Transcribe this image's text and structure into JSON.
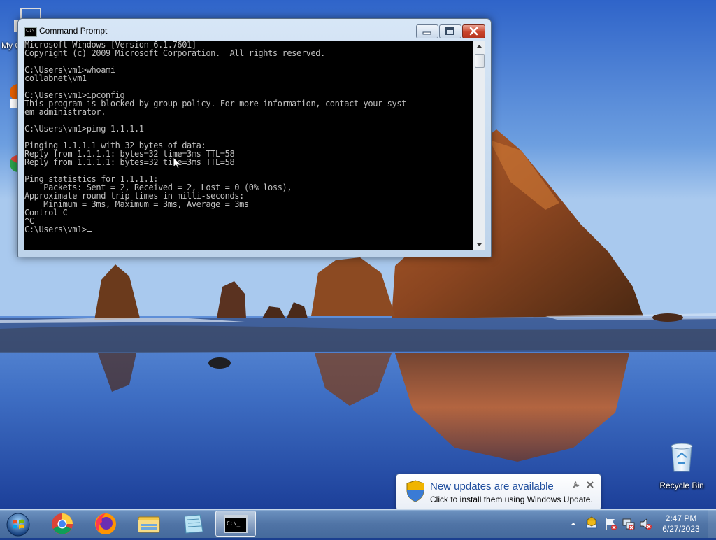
{
  "cmd": {
    "title": "Command Prompt",
    "lines": [
      "Microsoft Windows [Version 6.1.7601]",
      "Copyright (c) 2009 Microsoft Corporation.  All rights reserved.",
      "",
      "C:\\Users\\vm1>whoami",
      "collabnet\\vm1",
      "",
      "C:\\Users\\vm1>ipconfig",
      "This program is blocked by group policy. For more information, contact your syst",
      "em administrator.",
      "",
      "C:\\Users\\vm1>ping 1.1.1.1",
      "",
      "Pinging 1.1.1.1 with 32 bytes of data:",
      "Reply from 1.1.1.1: bytes=32 time=3ms TTL=58",
      "Reply from 1.1.1.1: bytes=32 time=3ms TTL=58",
      "",
      "Ping statistics for 1.1.1.1:",
      "    Packets: Sent = 2, Received = 2, Lost = 0 (0% loss),",
      "Approximate round trip times in milli-seconds:",
      "    Minimum = 3ms, Maximum = 3ms, Average = 3ms",
      "Control-C",
      "^C"
    ],
    "prompt": "C:\\Users\\vm1>"
  },
  "desktop": {
    "recycle_bin_label": "Recycle Bin",
    "partial_icon_label": "My C"
  },
  "notification": {
    "title": "New updates are available",
    "body": "Click to install them using Windows Update."
  },
  "taskbar": {
    "items": [
      "start-orb-icon",
      "chrome-icon",
      "firefox-icon",
      "file-explorer-icon",
      "notepad-icon",
      "command-prompt-icon"
    ],
    "active_item": "command-prompt-icon"
  },
  "clock": {
    "time": "2:47 PM",
    "date": "6/27/2023"
  }
}
